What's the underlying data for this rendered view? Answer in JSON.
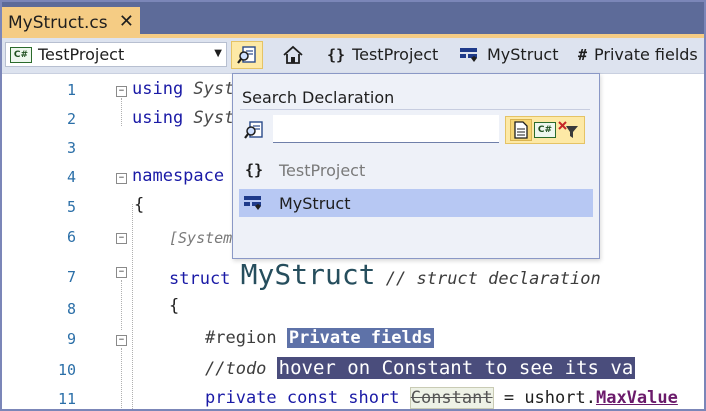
{
  "tab": {
    "title": "MyStruct.cs",
    "close_glyph": "✕"
  },
  "navbar": {
    "project_badge": "C#",
    "project": "TestProject",
    "crumbs": [
      {
        "glyph": "{}",
        "label": "TestProject"
      },
      {
        "label": "MyStruct"
      },
      {
        "glyph": "#",
        "label": "Private fields"
      }
    ]
  },
  "popup": {
    "title": "Search Declaration",
    "search_value": "",
    "filter_badge": "C#",
    "results": [
      {
        "glyph": "{}",
        "label": "TestProject",
        "dimmed": true
      },
      {
        "label": "MyStruct",
        "selected": true
      }
    ]
  },
  "editor": {
    "line_numbers": [
      "1",
      "2",
      "3",
      "4",
      "5",
      "6",
      "7",
      "8",
      "9",
      "10",
      "11"
    ],
    "lines": {
      "l1_kw": "using",
      "l1_rest": " Syst",
      "l2_kw": "using",
      "l2_rest": " Syst",
      "l4_kw": "namespace",
      "l5_brace": "{",
      "l6_attr": "[System",
      "l7_kw": "struct",
      "l7_name": "MyStruct",
      "l7_comment": "// struct declaration",
      "l8_brace": "{",
      "l9_region": "#region",
      "l9_label": "Private fields",
      "l10_todo": "//todo",
      "l10_text": "hover on Constant to see its va",
      "l11_kw": "private const short",
      "l11_name": "Constant",
      "l11_eq": " = ushort.",
      "l11_member": "MaxValue"
    }
  },
  "colors": {
    "tab_active": "#f5cc84",
    "tabstrip": "#5d6b99",
    "selected_result": "#b7c8f3",
    "line_number": "#2b6fa8"
  }
}
